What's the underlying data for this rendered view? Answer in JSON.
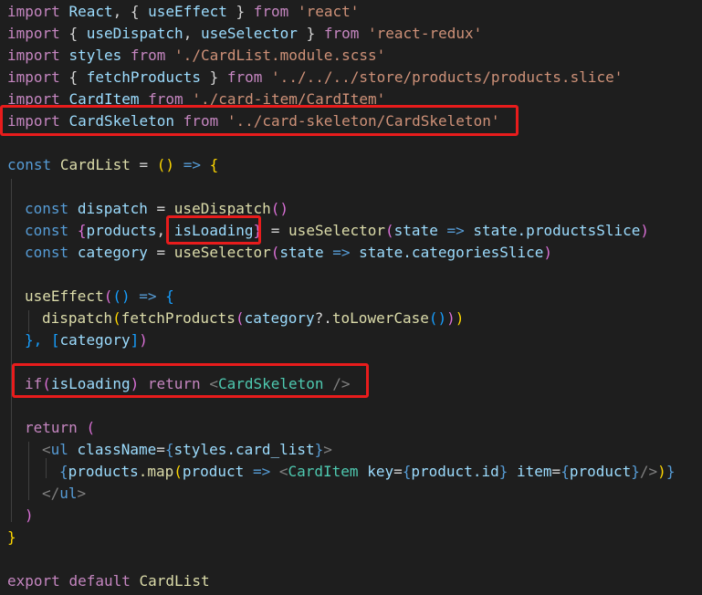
{
  "code": {
    "l1": {
      "kw": "import",
      "a": "React",
      "b": ", {",
      "c": "useEffect",
      "d": "}",
      "e": "from",
      "f": "'react'"
    },
    "l2": {
      "kw": "import",
      "a": "{",
      "b": "useDispatch",
      "c": ", ",
      "d": "useSelector",
      "e": "}",
      "f": "from",
      "g": "'react-redux'"
    },
    "l3": {
      "kw": "import",
      "a": "styles",
      "b": "from",
      "c": "'./CardList.module.scss'"
    },
    "l4": {
      "kw": "import",
      "a": "{",
      "b": "fetchProducts",
      "c": "}",
      "d": "from",
      "e": "'../../../store/products/products.slice'"
    },
    "l5": {
      "kw": "import",
      "a": "CardItem",
      "b": "from",
      "c": "'./card-item/CardItem'"
    },
    "l6": {
      "kw": "import",
      "a": "CardSkeleton",
      "b": "from",
      "c": "'../card-skeleton/CardSkeleton'"
    },
    "l8": {
      "kw": "const",
      "a": "CardList",
      "b": "=",
      "c": "()",
      "d": "=>",
      "e": "{"
    },
    "l10": {
      "kw": "const",
      "a": "dispatch",
      "b": "=",
      "c": "useDispatch",
      "d": "()"
    },
    "l11": {
      "kw": "const",
      "a": "{",
      "b": "products",
      "c": ", ",
      "d": "isLoading",
      "e": "}",
      "f": "=",
      "g": "useSelector",
      "h": "(",
      "i": "state",
      "j": "=>",
      "k": "state",
      "l": ".productsSlice",
      "m": ")"
    },
    "l12": {
      "kw": "const",
      "a": "category",
      "b": "=",
      "c": "useSelector",
      "d": "(",
      "e": "state",
      "f": "=>",
      "g": "state",
      "h": ".categoriesSlice",
      "i": ")"
    },
    "l14": {
      "a": "useEffect",
      "b": "(",
      "c": "()",
      "d": "=>",
      "e": "{"
    },
    "l15": {
      "a": "dispatch",
      "b": "(",
      "c": "fetchProducts",
      "d": "(",
      "e": "category",
      "f": "?.",
      "g": "toLowerCase",
      "h": "()",
      "i": ")",
      "j": ")"
    },
    "l16": {
      "a": "},",
      "b": "[",
      "c": "category",
      "d": "]",
      "e": ")"
    },
    "l18": {
      "a": "if",
      "b": "(",
      "c": "isLoading",
      "d": ")",
      "e": "return",
      "f": "<",
      "g": "CardSkeleton",
      "h": " />"
    },
    "l20": {
      "a": "return",
      "b": "("
    },
    "l21": {
      "a": "<",
      "b": "ul",
      "c": "className",
      "d": "=",
      "e": "{",
      "f": "styles",
      "g": ".card_list",
      "h": "}",
      "i": ">"
    },
    "l22": {
      "a": "{",
      "b": "products",
      "c": ".map",
      "d": "(",
      "e": "product",
      "f": "=>",
      "g": "<",
      "h": "CardItem",
      "i": "key",
      "j": "=",
      "k": "{",
      "l": "product",
      "m": ".id",
      "n": "}",
      "o": "item",
      "p": "=",
      "q": "{",
      "r": "product",
      "s": "}",
      "t": "/>",
      "u": ")",
      "v": "}"
    },
    "l23": {
      "a": "</",
      "b": "ul",
      "c": ">"
    },
    "l24": {
      "a": ")"
    },
    "l25": {
      "a": "}"
    },
    "l27": {
      "a": "export",
      "b": "default",
      "c": "CardList"
    }
  },
  "colors": {
    "background": "#1e1e1e",
    "highlight_box": "#e81c1c"
  }
}
